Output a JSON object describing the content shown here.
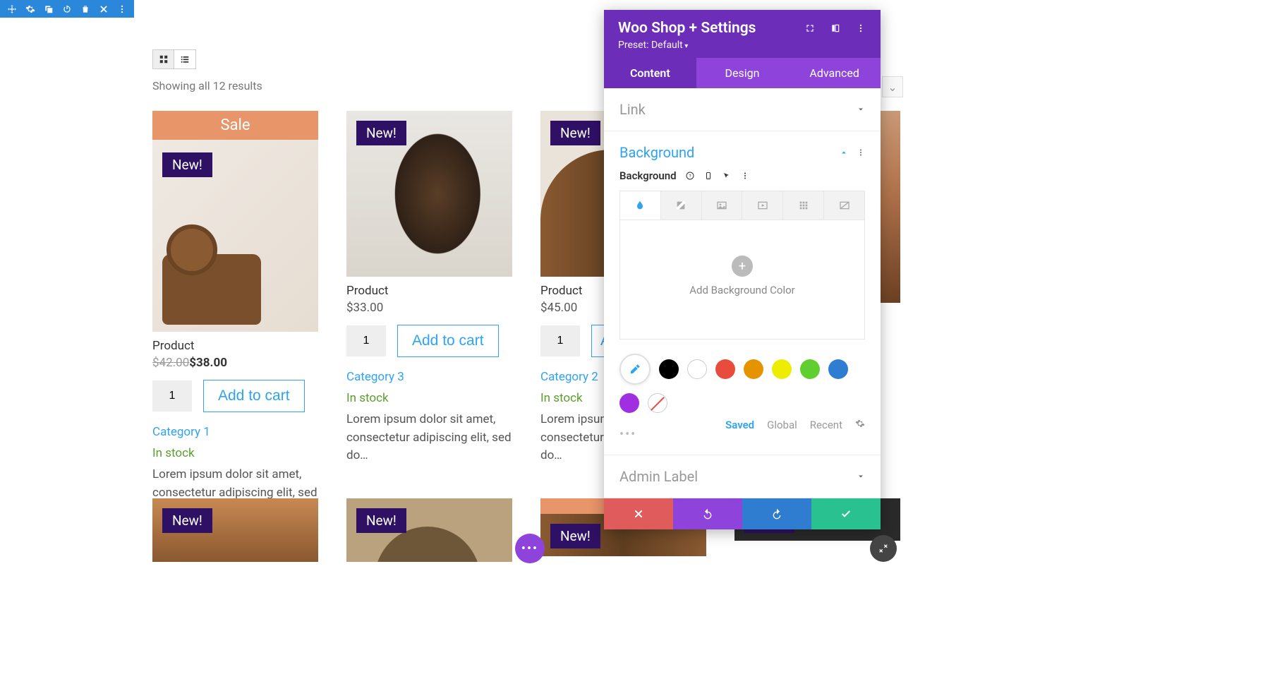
{
  "top_toolbar_icons": [
    "move",
    "gear",
    "duplicate",
    "power",
    "trash",
    "close",
    "more"
  ],
  "shop": {
    "results_text": "Showing all 12 results",
    "sale_label": "Sale",
    "new_label": "New!",
    "add_to_cart": "Add to cart",
    "in_stock": "In stock",
    "products_row1": [
      {
        "title": "Product",
        "old_price": "$42.00",
        "price": "$38.00",
        "sale": true,
        "category": "Category 1",
        "qty": "1",
        "desc": "Lorem ipsum dolor sit amet, consectetur adipiscing elit, sed do…"
      },
      {
        "title": "Product",
        "price": "$33.00",
        "category": "Category 3",
        "qty": "1",
        "desc": "Lorem ipsum dolor sit amet, consectetur adipiscing elit, sed do…"
      },
      {
        "title": "Product",
        "price": "$45.00",
        "category": "Category 2",
        "qty": "1",
        "desc": "Lorem ipsum dolor sit amet, consectetur adipiscing elit, sed do…"
      },
      {
        "title": "",
        "price": "",
        "category": "",
        "qty": "",
        "desc": ""
      }
    ],
    "products_row2_new": true
  },
  "panel": {
    "title": "Woo Shop + Settings",
    "subtitle": "Preset: Default",
    "tabs": {
      "content": "Content",
      "design": "Design",
      "advanced": "Advanced"
    },
    "sections": {
      "link": "Link",
      "background": "Background",
      "admin_label": "Admin Label"
    },
    "bg_field_label": "Background",
    "add_bg_text": "Add Background Color",
    "color_tabs": {
      "saved": "Saved",
      "global": "Global",
      "recent": "Recent"
    },
    "swatches": [
      "#000000",
      "#ffffff",
      "#e74c3c",
      "#e59400",
      "#eded00",
      "#5fce2f",
      "#2e7dd1",
      "#9f2fe0"
    ],
    "footer_colors": {
      "cancel": "#e05b5b",
      "undo": "#8e44db",
      "redo": "#2e7dd1",
      "confirm": "#29c18f"
    }
  }
}
